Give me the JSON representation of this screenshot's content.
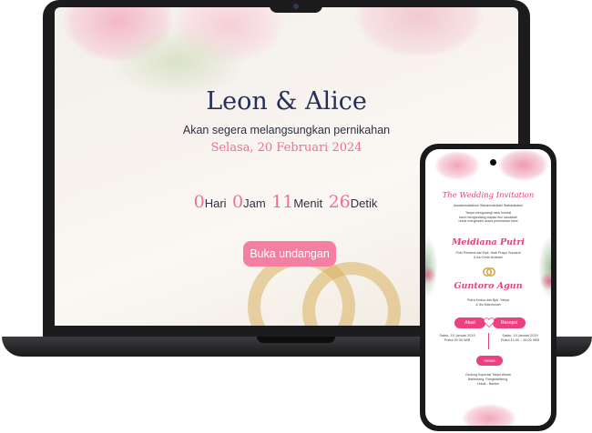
{
  "laptop": {
    "title": "Leon & Alice",
    "subtitle": "Akan segera melangsungkan pernikahan",
    "date": "Selasa, 20 Februari 2024",
    "countdown": {
      "days_value": "0",
      "days_label": "Hari",
      "hours_value": "0",
      "hours_label": "Jam",
      "minutes_value": "11",
      "minutes_label": "Menit",
      "seconds_value": "26",
      "seconds_label": "Detik"
    },
    "open_button": "Buka undangan"
  },
  "phone": {
    "heading": "The Wedding Invitation",
    "greeting": "Assalamualaikum Warahmatullahi Wabarakatuh",
    "intro_1": "Tanpa mengurangi rasa hormat",
    "intro_2": "kami mengundang bapak/ ibu/ saudara/i",
    "intro_3": "untuk menghadiri acara pernikahan kami",
    "bride_name": "Meidiana Putri",
    "bride_parents_1": "Putri Pertama dari Bpk. Hadi Puspo Sumardi",
    "bride_parents_2": "& Ibu Dede Andriani",
    "groom_name": "Guntoro Agun",
    "groom_parents_1": "Putra Kedua dari Bpk. Yahya",
    "groom_parents_2": "& Ibu Maemunah",
    "akad_button": "Akad",
    "resepsi_button": "Resepsi",
    "akad_date": "Sabtu, 19 Januari 2019",
    "akad_time": "Pukul 09.00 WIB",
    "resepsi_date": "Sabtu, 19 Januari 2019",
    "resepsi_time": "Pukul 10.00 – 16.00 WIB",
    "venue_button": "Venue",
    "address_1": "Gedung Koperasi Tekad Waras",
    "address_2": "Narimbang, Rangkasbitung,",
    "address_3": "Lebak - Banten"
  },
  "colors": {
    "accent": "#ee6f98",
    "button": "#f57fa3",
    "title": "#25305a",
    "phone_accent": "#e0457f"
  }
}
